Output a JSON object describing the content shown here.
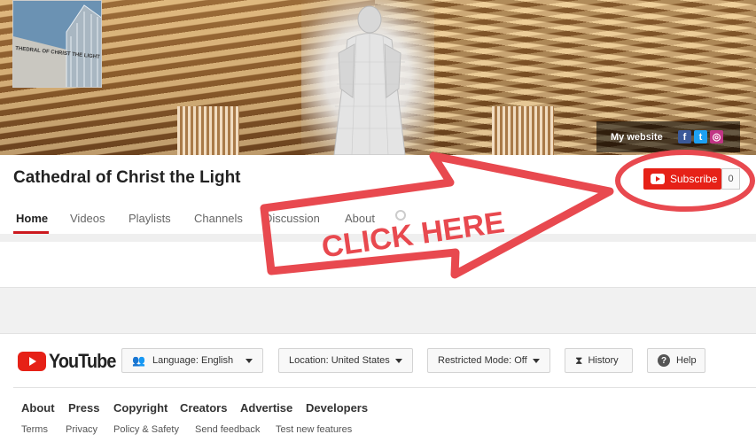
{
  "banner": {
    "avatar_text": "THEDRAL OF CHRIST THE LIGHT",
    "my_website_label": "My website",
    "social_icons": [
      "facebook-icon",
      "twitter-icon",
      "instagram-icon"
    ]
  },
  "channel": {
    "title": "Cathedral of Christ the Light",
    "subscribe_label": "Subscribe",
    "subscriber_count": "0"
  },
  "tabs": [
    {
      "label": "Home",
      "active": true
    },
    {
      "label": "Videos",
      "active": false
    },
    {
      "label": "Playlists",
      "active": false
    },
    {
      "label": "Channels",
      "active": false
    },
    {
      "label": "Discussion",
      "active": false
    },
    {
      "label": "About",
      "active": false
    }
  ],
  "overlay": {
    "callout_text": "CLICK HERE",
    "color": "#e8494f"
  },
  "footer": {
    "logo_text": "YouTube",
    "language_prefix": "Language:",
    "language_value": "English",
    "location_prefix": "Location:",
    "location_value": "United States",
    "restricted_prefix": "Restricted Mode:",
    "restricted_value": "Off",
    "history_label": "History",
    "help_label": "Help",
    "links_primary": [
      "About",
      "Press",
      "Copyright",
      "Creators",
      "Advertise",
      "Developers"
    ],
    "links_secondary": [
      "Terms",
      "Privacy",
      "Policy & Safety",
      "Send feedback",
      "Test new features"
    ]
  },
  "colors": {
    "youtube_red": "#e62117",
    "tab_underline": "#cc181e"
  }
}
